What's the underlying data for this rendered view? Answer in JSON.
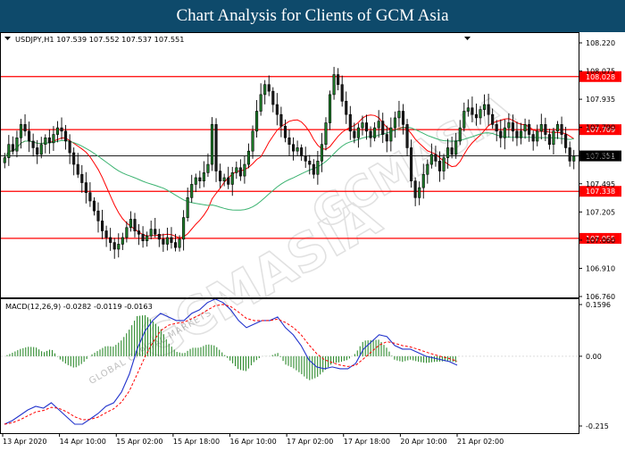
{
  "banner": {
    "title": "Chart Analysis for Clients of GCM Asia"
  },
  "watermark": {
    "main": "GCMASIA",
    "sub": "GLOBAL CAPITAL MARKETS",
    "repeat": "GCMASIA"
  },
  "colors": {
    "banner": "#0e4a6b",
    "bull": "#1e7d2a",
    "bear": "#1a1a1a",
    "ma_fast": "#ff0000",
    "ma_slow": "#3cb371",
    "level": "#ff0000",
    "current": "#000000",
    "macd_hist": "#2e8b2e",
    "macd_line": "#2233cc",
    "macd_signal": "#ff0000"
  },
  "chart_data": [
    {
      "type": "candlestick",
      "header": "USDJPY,H1  107.539 107.552 107.537 107.551",
      "symbol": "USDJPY,H1",
      "ohlc_label": {
        "open": "107.539",
        "high": "107.552",
        "low": "107.537",
        "close": "107.551"
      },
      "ylim": [
        106.7,
        108.29
      ],
      "y_ticks": [
        "108.220",
        "108.075",
        "107.935",
        "107.790",
        "107.645",
        "107.495",
        "107.205",
        "107.060",
        "106.910",
        "106.760"
      ],
      "x_ticks": [
        "13 Apr 2020",
        "14 Apr 10:00",
        "15 Apr 02:00",
        "15 Apr 18:00",
        "16 Apr 10:00",
        "17 Apr 02:00",
        "17 Apr 18:00",
        "20 Apr 10:00",
        "21 Apr 02:00"
      ],
      "levels": [
        {
          "label": "108.028",
          "value": 108.028
        },
        {
          "label": "107.709",
          "value": 107.709
        },
        {
          "label": "107.338",
          "value": 107.338
        },
        {
          "label": "107.055",
          "value": 107.055
        }
      ],
      "current_price": {
        "label": "107.551",
        "value": 107.551
      },
      "closes": [
        107.54,
        107.62,
        107.58,
        107.66,
        107.74,
        107.7,
        107.64,
        107.6,
        107.56,
        107.62,
        107.66,
        107.63,
        107.68,
        107.72,
        107.7,
        107.64,
        107.57,
        107.5,
        107.44,
        107.39,
        107.33,
        107.28,
        107.22,
        107.16,
        107.1,
        107.06,
        107.03,
        106.99,
        107.02,
        107.06,
        107.12,
        107.17,
        107.1,
        107.08,
        107.04,
        107.07,
        107.11,
        107.08,
        107.05,
        107.02,
        107.06,
        107.03,
        107.0,
        107.05,
        107.18,
        107.3,
        107.38,
        107.42,
        107.4,
        107.45,
        107.5,
        107.74,
        107.46,
        107.4,
        107.42,
        107.38,
        107.45,
        107.48,
        107.43,
        107.5,
        107.58,
        107.7,
        107.82,
        107.92,
        107.98,
        107.94,
        107.86,
        107.8,
        107.73,
        107.66,
        107.62,
        107.58,
        107.6,
        107.55,
        107.52,
        107.5,
        107.44,
        107.52,
        107.62,
        107.75,
        107.92,
        108.04,
        107.98,
        107.88,
        107.8,
        107.7,
        107.66,
        107.72,
        107.75,
        107.7,
        107.66,
        107.72,
        107.76,
        107.68,
        107.64,
        107.72,
        107.78,
        107.82,
        107.74,
        107.6,
        107.4,
        107.3,
        107.36,
        107.44,
        107.5,
        107.56,
        107.52,
        107.46,
        107.54,
        107.6,
        107.56,
        107.64,
        107.72,
        107.82,
        107.84,
        107.8,
        107.78,
        107.83,
        107.86,
        107.8,
        107.74,
        107.7,
        107.66,
        107.72,
        107.75,
        107.7,
        107.66,
        107.7,
        107.74,
        107.68,
        107.64,
        107.7,
        107.74,
        107.68,
        107.62,
        107.7,
        107.74,
        107.68,
        107.6,
        107.52,
        107.55
      ],
      "macd_ylim": [
        -0.215,
        0.1596
      ],
      "macd_ticks": [
        "0.1596",
        "0.00",
        "-0.215"
      ],
      "macd_label": "MACD(12,26,9) -0.0282 -0.0119 -0.0163"
    },
    {
      "type": "line",
      "series": [
        {
          "values": [
            -0.19,
            -0.18,
            -0.165,
            -0.15,
            -0.14,
            -0.145,
            -0.13,
            -0.15,
            -0.17,
            -0.19,
            -0.19,
            -0.175,
            -0.16,
            -0.14,
            -0.13,
            -0.1,
            -0.05,
            0.02,
            0.07,
            0.1,
            0.12,
            0.11,
            0.1,
            0.1,
            0.12,
            0.13,
            0.15,
            0.16,
            0.15,
            0.13,
            0.1,
            0.08,
            0.09,
            0.1,
            0.1,
            0.11,
            0.08,
            0.06,
            0.03,
            -0.01,
            -0.03,
            -0.035,
            -0.03,
            -0.035,
            -0.035,
            -0.02,
            0.02,
            0.04,
            0.06,
            0.055,
            0.03,
            0.02,
            0.02,
            0.01,
            0.0,
            -0.005,
            -0.01,
            -0.015,
            -0.025
          ]
        }
      ]
    }
  ]
}
